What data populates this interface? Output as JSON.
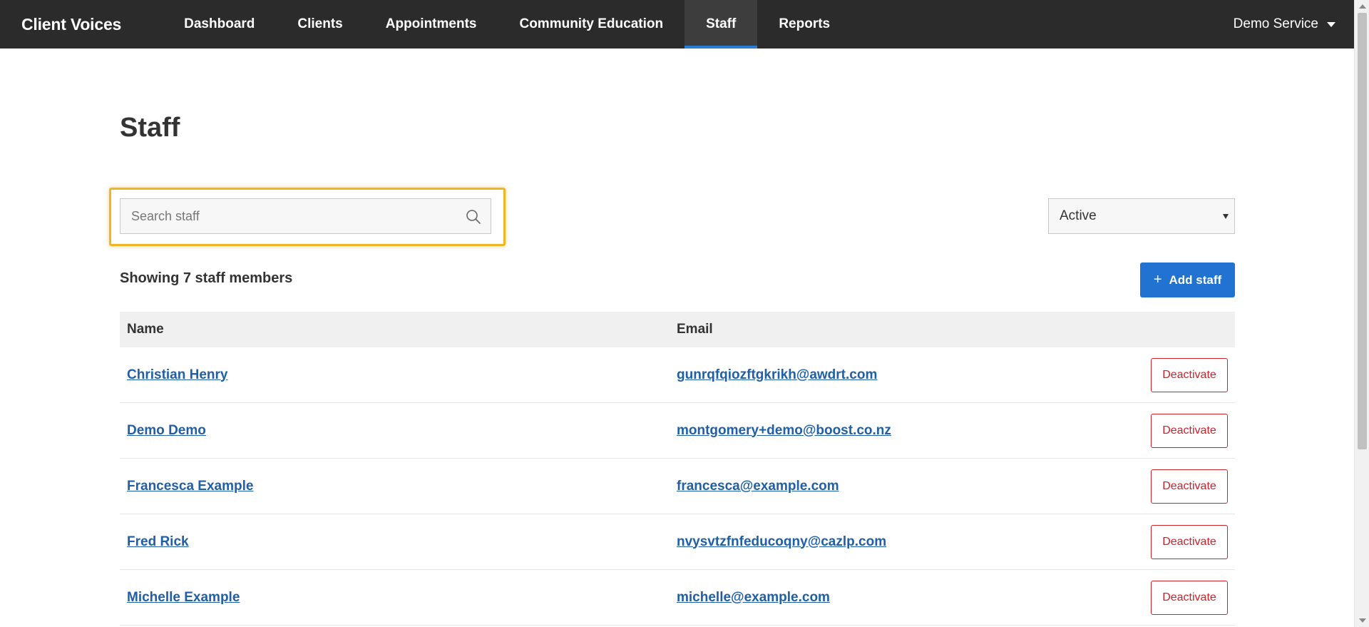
{
  "app": {
    "brand": "Client Voices"
  },
  "nav": {
    "items": [
      {
        "label": "Dashboard"
      },
      {
        "label": "Clients"
      },
      {
        "label": "Appointments"
      },
      {
        "label": "Community Education"
      },
      {
        "label": "Staff",
        "active": true
      },
      {
        "label": "Reports"
      }
    ],
    "account_label": "Demo Service"
  },
  "page": {
    "title": "Staff",
    "search": {
      "placeholder": "Search staff",
      "value": ""
    },
    "status_filter": {
      "selected": "Active"
    },
    "count_text": "Showing 7 staff members",
    "add_button_label": "Add staff"
  },
  "table": {
    "headers": {
      "name": "Name",
      "email": "Email"
    },
    "action_label": "Deactivate",
    "rows": [
      {
        "name": "Christian Henry",
        "email": "gunrqfqiozftgkrikh@awdrt.com"
      },
      {
        "name": "Demo Demo",
        "email": "montgomery+demo@boost.co.nz"
      },
      {
        "name": "Francesca Example",
        "email": "francesca@example.com"
      },
      {
        "name": "Fred Rick",
        "email": "nvysvtzfnfeducoqny@cazlp.com"
      },
      {
        "name": "Michelle Example",
        "email": "michelle@example.com"
      }
    ]
  },
  "colors": {
    "nav_bg": "#2b2b2b",
    "accent": "#2273d1",
    "link": "#1f5fa8",
    "danger": "#d0202a",
    "focus": "#f0b429"
  }
}
